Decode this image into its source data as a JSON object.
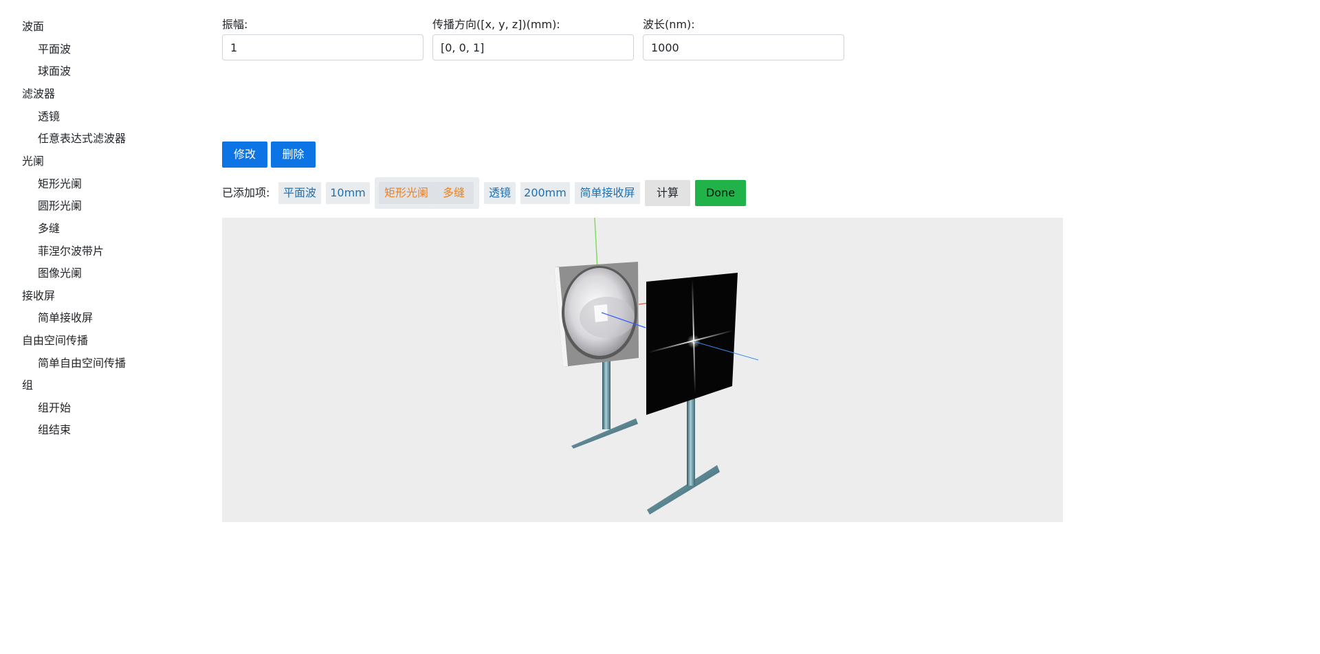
{
  "sidebar": {
    "categories": [
      {
        "label": "波面",
        "items": [
          "平面波",
          "球面波"
        ]
      },
      {
        "label": "滤波器",
        "items": [
          "透镜",
          "任意表达式滤波器"
        ]
      },
      {
        "label": "光阑",
        "items": [
          "矩形光阑",
          "圆形光阑",
          "多缝",
          "菲涅尔波带片",
          "图像光阑"
        ]
      },
      {
        "label": "接收屏",
        "items": [
          "简单接收屏"
        ]
      },
      {
        "label": "自由空间传播",
        "items": [
          "简单自由空间传播"
        ]
      },
      {
        "label": "组",
        "items": [
          "组开始",
          "组结束"
        ]
      }
    ]
  },
  "form": {
    "amplitude": {
      "label": "振幅:",
      "value": "1"
    },
    "direction": {
      "label": "传播方向([x, y, z])(mm):",
      "value": "[0, 0, 1]"
    },
    "wavelength": {
      "label": "波长(nm):",
      "value": "1000"
    }
  },
  "actions": {
    "modify": "修改",
    "delete": "删除"
  },
  "added": {
    "label": "已添加项:",
    "chips": [
      "平面波",
      "10mm"
    ],
    "group_chips": [
      "矩形光阑",
      "多缝"
    ],
    "chips_after": [
      "透镜",
      "200mm",
      "简单接收屏"
    ],
    "calc": "计算",
    "done": "Done"
  },
  "colors": {
    "primary": "#0d74e6",
    "done": "#21b34a",
    "chip_text": "#1f6fb0",
    "group_chip_text": "#f07f1c",
    "viewport_bg": "#ededed"
  }
}
